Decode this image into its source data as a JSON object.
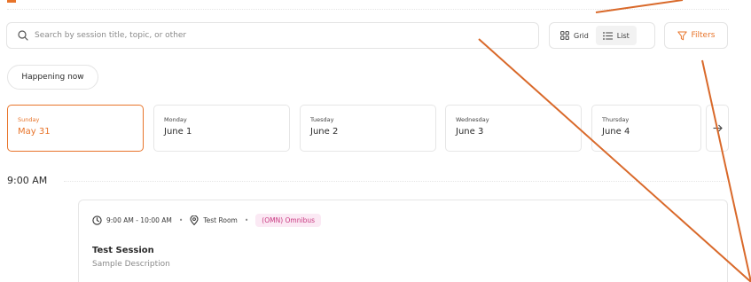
{
  "search": {
    "placeholder": "Search by session title, topic, or other"
  },
  "view_toggle": {
    "grid_label": "Grid",
    "list_label": "List",
    "active": "list"
  },
  "filters": {
    "label": "Filters"
  },
  "happening_now": {
    "label": "Happening now"
  },
  "days": [
    {
      "dow": "Sunday",
      "date": "May 31",
      "active": true
    },
    {
      "dow": "Monday",
      "date": "June 1",
      "active": false
    },
    {
      "dow": "Tuesday",
      "date": "June 2",
      "active": false
    },
    {
      "dow": "Wednesday",
      "date": "June 3",
      "active": false
    },
    {
      "dow": "Thursday",
      "date": "June 4",
      "active": false
    }
  ],
  "time_slot": {
    "label": "9:00 AM"
  },
  "session": {
    "time": "9:00 AM - 10:00 AM",
    "room": "Test Room",
    "track": "(OMN) Omnibus",
    "title": "Test Session",
    "description": "Sample Description"
  },
  "colors": {
    "accent": "#e8742a",
    "track_bg": "#fbe9f4",
    "track_text": "#c8377f",
    "border": "#e6e6e6",
    "muted_text": "#8a8a8a"
  },
  "icons": {
    "search": "search-icon",
    "grid": "grid-icon",
    "list": "list-icon",
    "filter": "filter-icon",
    "next": "arrow-right-icon",
    "clock": "clock-icon",
    "location": "location-pin-icon"
  }
}
